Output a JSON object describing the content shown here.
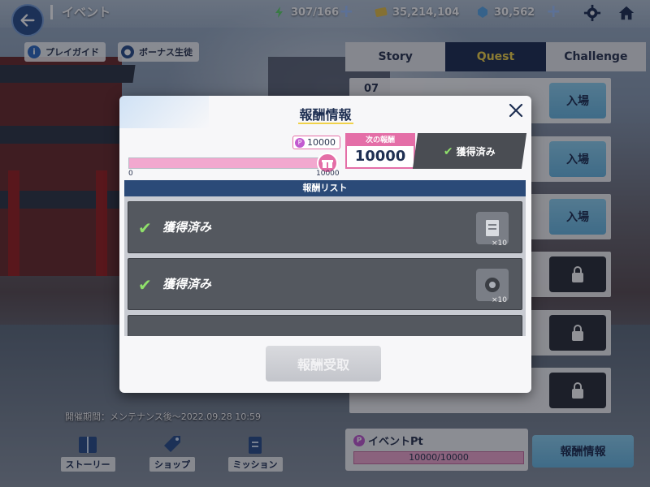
{
  "topbar": {
    "title": "イベント",
    "stamina": "307/166",
    "gold": "35,214,104",
    "gems": "30,562"
  },
  "chips": {
    "guide": "プレイガイド",
    "bonus": "ボーナス生徒"
  },
  "tabs": [
    {
      "label": "Story"
    },
    {
      "label": "Quest"
    },
    {
      "label": "Challenge"
    }
  ],
  "stages": {
    "first_number": "07",
    "enter_label": "入場"
  },
  "event_period": "開催期間：メンテナンス後～2022.09.28 10:59",
  "bottom_nav": [
    {
      "label": "ストーリー"
    },
    {
      "label": "ショップ"
    },
    {
      "label": "ミッション"
    }
  ],
  "event_pt": {
    "label": "イベントPt",
    "progress_text": "10000/10000",
    "progress_fraction": 1.0
  },
  "reward_info_button": "報酬情報",
  "modal": {
    "title": "報酬情報",
    "bubble_value": "10000",
    "progress_fraction": 1.0,
    "tick_min": "0",
    "tick_max": "10000",
    "next_reward_label": "次の報酬",
    "next_reward_value": "10000",
    "claimed_label": "獲得済み",
    "list_header": "報酬リスト",
    "rows": [
      {
        "status": "獲得済み",
        "qty": "×10",
        "icon": "document-icon"
      },
      {
        "status": "獲得済み",
        "qty": "×10",
        "icon": "gear-item-icon"
      }
    ],
    "receive_button": "報酬受取"
  },
  "colors": {
    "accent_yellow": "#f5d64a",
    "navy": "#1e2f52",
    "pink": "#e46ea7",
    "check_green": "#8fe06a"
  }
}
